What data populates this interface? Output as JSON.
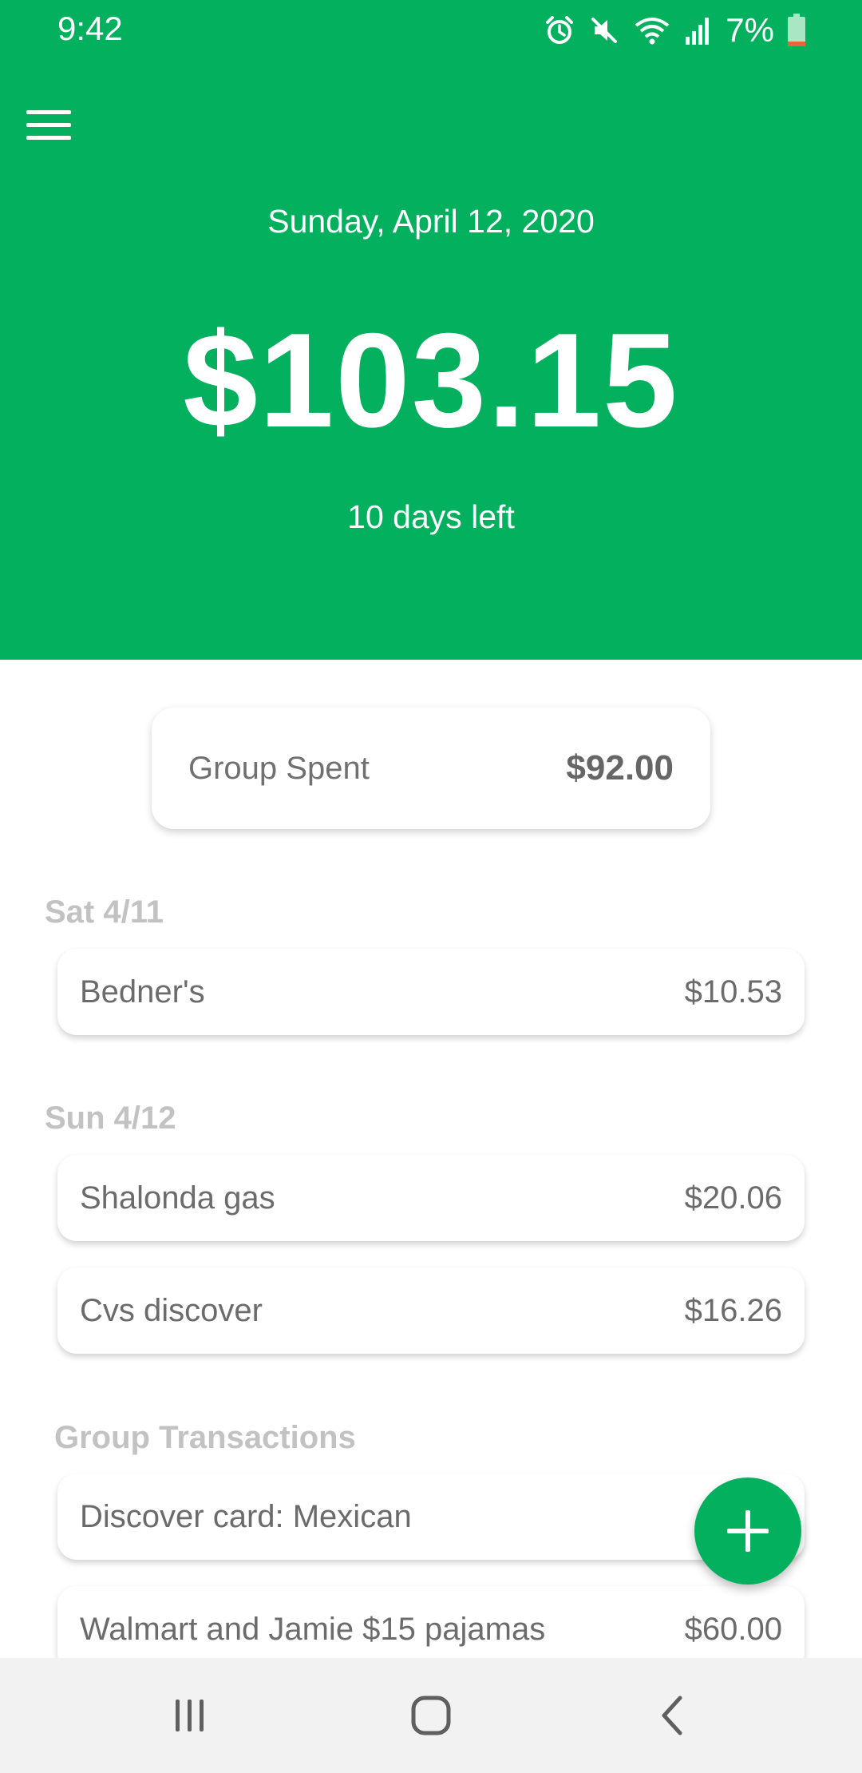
{
  "status_bar": {
    "time": "9:42",
    "battery_percent": "7%",
    "icons": [
      "alarm-icon",
      "mute-icon",
      "wifi-icon",
      "signal-icon",
      "battery-icon"
    ]
  },
  "header": {
    "menu_icon": "hamburger-menu-icon",
    "date": "Sunday, April 12, 2020",
    "amount": "$103.15",
    "days_left": "10 days left",
    "background_color": "#02b05e"
  },
  "group_spent": {
    "label": "Group Spent",
    "value": "$92.00"
  },
  "sections": [
    {
      "title": "Sat 4/11",
      "transactions": [
        {
          "name": "Bedner's",
          "amount": "$10.53"
        }
      ]
    },
    {
      "title": "Sun 4/12",
      "transactions": [
        {
          "name": "Shalonda gas",
          "amount": "$20.06"
        },
        {
          "name": "Cvs discover",
          "amount": "$16.26"
        }
      ]
    },
    {
      "title": "Group Transactions",
      "transactions": [
        {
          "name": "Discover card: Mexican",
          "amount": "$"
        },
        {
          "name": "Walmart and Jamie $15 pajamas",
          "amount": "$60.00"
        }
      ]
    }
  ],
  "fab": {
    "icon": "plus-icon",
    "color": "#02b05e"
  },
  "nav_bar": {
    "icons": [
      "recent-apps-icon",
      "home-icon",
      "back-icon"
    ]
  }
}
